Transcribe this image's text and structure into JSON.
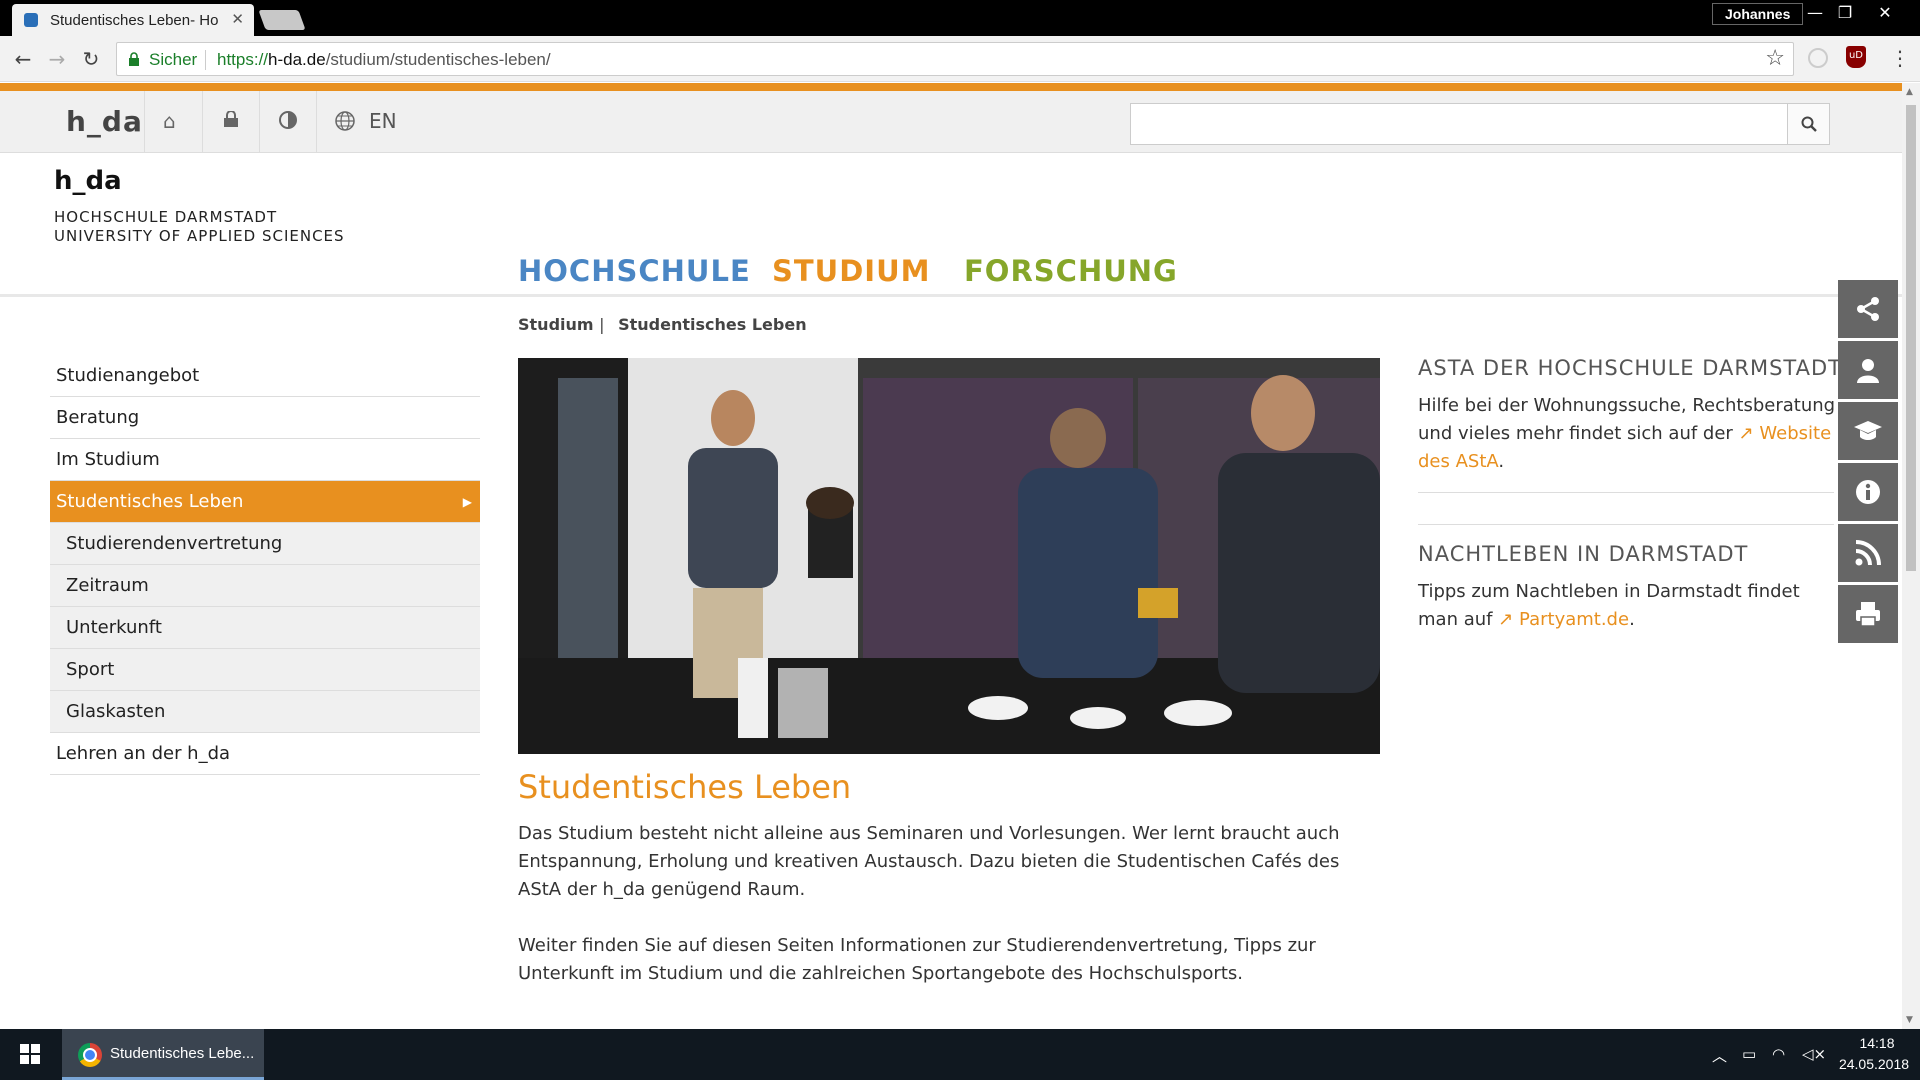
{
  "browser": {
    "tab_title": "Studentisches Leben- Ho",
    "tab_close": "✕",
    "profile_name": "Johannes",
    "window_controls": {
      "minimize": "—",
      "restore": "❐",
      "close": "✕"
    },
    "secure_label": "Sicher",
    "url_scheme": "https://",
    "url_host": "h-da.de",
    "url_path": "/studium/studentisches-leben/",
    "ublock_badge": "uD"
  },
  "site": {
    "topbar_logo": "h_da",
    "language": "EN",
    "search_placeholder": "",
    "logo": {
      "name": "h_da",
      "line1": "HOCHSCHULE DARMSTADT",
      "line2": "UNIVERSITY OF APPLIED SCIENCES"
    },
    "main_nav": [
      {
        "label": "HOCHSCHULE",
        "color": "#4a86c4"
      },
      {
        "label": "STUDIUM",
        "color": "#e8901f"
      },
      {
        "label": "FORSCHUNG",
        "color": "#86a62a"
      }
    ],
    "breadcrumb": {
      "first": "Studium",
      "separator": "|",
      "second": "Studentisches Leben"
    },
    "sidebar": {
      "items": [
        {
          "label": "Studienangebot"
        },
        {
          "label": "Beratung"
        },
        {
          "label": "Im Studium"
        },
        {
          "label": "Studentisches Leben",
          "active": true
        },
        {
          "label": "Studierendenvertretung"
        },
        {
          "label": "Zeitraum"
        },
        {
          "label": "Unterkunft"
        },
        {
          "label": "Sport"
        },
        {
          "label": "Glaskasten"
        },
        {
          "label": "Lehren an der h_da"
        }
      ]
    },
    "article": {
      "title": "Studentisches Leben",
      "p1": "Das Studium besteht nicht alleine aus Seminaren und Vorlesungen. Wer lernt braucht auch Entspannung, Erholung und kreativen Austausch. Dazu bieten die Studentischen Cafés des AStA der h_da genügend Raum.",
      "p2": "Weiter finden Sie auf diesen Seiten Informationen zur Studierendenvertretung, Tipps zur Unterkunft im Studium und die zahlreichen Sportangebote des Hochschulsports."
    },
    "aside": {
      "asta": {
        "heading": "ASTA DER HOCHSCHULE DARMSTADT",
        "text_before": "Hilfe bei der Wohnungssuche, Rechtsberatung und vieles mehr findet sich auf der ",
        "link": "Website des AStA",
        "text_after": "."
      },
      "nightlife": {
        "heading": "NACHTLEBEN IN DARMSTADT",
        "text_before": "Tipps zum Nachtleben in Darmstadt findet man auf ",
        "link": "Partyamt.de",
        "text_after": "."
      }
    },
    "side_tools": [
      "share-icon",
      "user-icon",
      "graduation-cap-icon",
      "info-icon",
      "rss-icon",
      "print-icon"
    ],
    "colors": {
      "accent": "#e8901f",
      "toolbar": "#666666"
    }
  },
  "taskbar": {
    "app_label": "Studentisches Lebe...",
    "time": "14:18",
    "date": "24.05.2018"
  }
}
